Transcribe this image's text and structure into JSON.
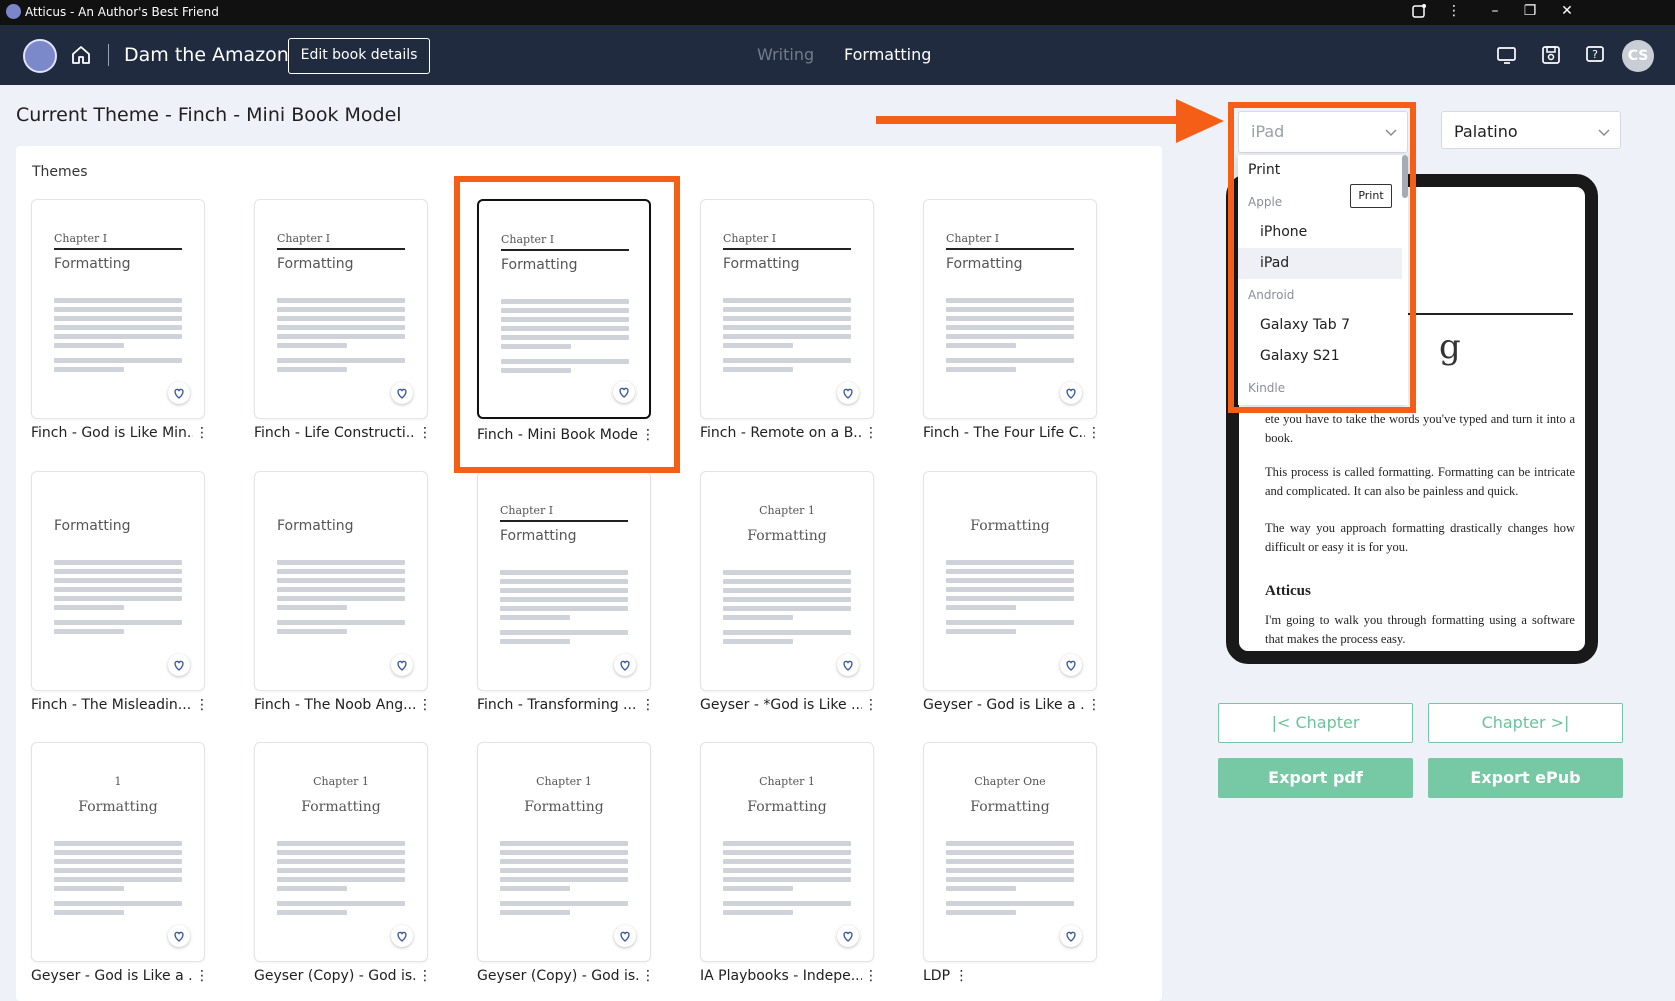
{
  "window": {
    "title": "Atticus - An Author's Best Friend"
  },
  "header": {
    "book_title": "Dam the Amazon",
    "edit_button": "Edit book details",
    "tabs": [
      "Writing",
      "Formatting"
    ],
    "active_tab": "Formatting",
    "avatar_initials": "CS",
    "icons": [
      "home-icon",
      "preview-icon",
      "save-icon",
      "help-icon"
    ]
  },
  "current_theme": "Current Theme - Finch - Mini Book Model",
  "themes_label": "Themes",
  "themes": [
    {
      "name": "Finch - God is Like Min...",
      "chapter": "Chapter I",
      "title": "Formatting"
    },
    {
      "name": "Finch - Life Constructi...",
      "chapter": "Chapter I",
      "title": "Formatting"
    },
    {
      "name": "Finch - Mini Book Model",
      "chapter": "Chapter I",
      "title": "Formatting"
    },
    {
      "name": "Finch - Remote on a B...",
      "chapter": "Chapter I",
      "title": "Formatting"
    },
    {
      "name": "Finch - The Four Life C...",
      "chapter": "Chapter I",
      "title": "Formatting"
    },
    {
      "name": "Finch - The Misleadin...",
      "chapter": "",
      "title": "Formatting"
    },
    {
      "name": "Finch - The Noob Ang...",
      "chapter": "",
      "title": "Formatting"
    },
    {
      "name": "Finch - Transforming ...",
      "chapter": "Chapter I",
      "title": "Formatting"
    },
    {
      "name": "Geyser - *God is Like ...",
      "chapter": "Chapter 1",
      "title": "Formatting"
    },
    {
      "name": "Geyser - God is Like a ...",
      "chapter": "",
      "title": "Formatting"
    },
    {
      "name": "Geyser - God is Like a ...",
      "chapter": "1",
      "title": "Formatting"
    },
    {
      "name": "Geyser (Copy) - God is...",
      "chapter": "Chapter 1",
      "title": "Formatting"
    },
    {
      "name": "Geyser (Copy) - God is...",
      "chapter": "Chapter 1",
      "title": "Formatting"
    },
    {
      "name": "IA Playbooks - Indepe...",
      "chapter": "Chapter 1",
      "title": "Formatting"
    },
    {
      "name": "LDP",
      "chapter": "Chapter One",
      "title": "Formatting"
    }
  ],
  "device_select": {
    "value": "iPad",
    "options": [
      {
        "label": "Print",
        "type": "item"
      },
      {
        "label": "Apple",
        "type": "group"
      },
      {
        "label": "iPhone",
        "type": "item"
      },
      {
        "label": "iPad",
        "type": "item",
        "active": true
      },
      {
        "label": "Android",
        "type": "group"
      },
      {
        "label": "Galaxy Tab 7",
        "type": "item"
      },
      {
        "label": "Galaxy S21",
        "type": "item"
      },
      {
        "label": "Kindle",
        "type": "group"
      }
    ],
    "tooltip": "Print"
  },
  "font_select": {
    "value": "Palatino"
  },
  "preview": {
    "big_letter": "g",
    "p1": "ete you have to take the words you've typed and turn it into a book.",
    "p2": "This process is called formatting. Formatting can be intricate and complicated. It can also be painless and quick.",
    "p3": "The way you approach formatting drastically changes how difficult or easy it is for you.",
    "heading": "Atticus",
    "p4": "I'm going to walk you through formatting using a software that makes the process easy."
  },
  "nav": {
    "prev": "Chapter",
    "next": "Chapter"
  },
  "export": {
    "pdf": "Export pdf",
    "epub": "Export ePub"
  },
  "colors": {
    "annotation": "#f45e17",
    "accent": "#77c8a5",
    "header": "#202b3f"
  }
}
